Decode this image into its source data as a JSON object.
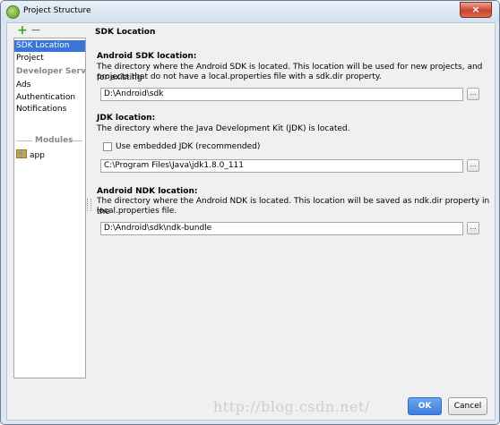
{
  "window": {
    "title": "Project Structure",
    "close_label": "×"
  },
  "toolbar": {
    "add_label": "+",
    "remove_label": "−"
  },
  "sidebar": {
    "items": [
      {
        "label": "SDK Location"
      },
      {
        "label": "Project"
      },
      {
        "label": "Developer Servic..."
      },
      {
        "label": "Ads"
      },
      {
        "label": "Authentication"
      },
      {
        "label": "Notifications"
      }
    ],
    "modules_header": "Modules",
    "modules": [
      {
        "label": "app"
      }
    ]
  },
  "content": {
    "section_title": "SDK Location",
    "android_sdk": {
      "label": "Android SDK location:",
      "desc_line1": "The directory where the Android SDK is located. This location will be used for new projects, and for existing",
      "desc_line2": "projects that do not have a local.properties file with a sdk.dir property.",
      "path": "D:\\Android\\sdk",
      "browse": "..."
    },
    "jdk": {
      "label": "JDK location:",
      "desc": "The directory where the Java Development Kit (JDK) is located.",
      "checkbox_label": "Use embedded JDK (recommended)",
      "checkbox_checked": false,
      "path": "C:\\Program Files\\Java\\jdk1.8.0_111",
      "browse": "..."
    },
    "ndk": {
      "label": "Android NDK location:",
      "desc_line1": "The directory where the Android NDK is located. This location will be saved as ndk.dir property in the",
      "desc_line2": "local.properties file.",
      "path": "D:\\Android\\sdk\\ndk-bundle",
      "browse": "..."
    }
  },
  "buttons": {
    "ok": "OK",
    "cancel": "Cancel"
  },
  "watermark": "http://blog.csdn.net/",
  "colors": {
    "selection": "#3875d7",
    "ok_button": "#3c7fdc",
    "add_icon": "#3aa31b"
  }
}
